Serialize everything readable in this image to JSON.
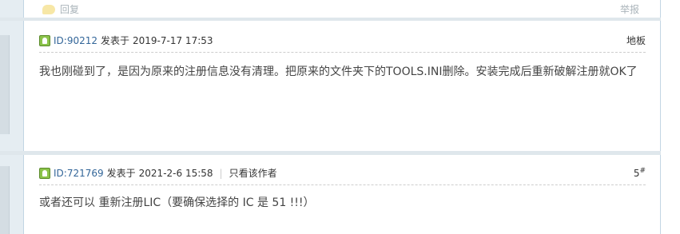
{
  "top_bar": {
    "reply_label": "回复",
    "report_label": "举报"
  },
  "posts": [
    {
      "author_id": "ID:90212",
      "posted_prefix": "发表于",
      "posted_time": "2019-7-17 17:53",
      "floor_label": "地板",
      "content": "我也刚碰到了，是因为原来的注册信息没有清理。把原来的文件夹下的TOOLS.INI删除。安装完成后重新破解注册就OK了"
    },
    {
      "author_id": "ID:721769",
      "posted_prefix": "发表于",
      "posted_time": "2021-2-6 15:58",
      "separator": "|",
      "only_author_label": "只看该作者",
      "floor_number": "5",
      "floor_suffix": "#",
      "content": "或者还可以 重新注册LIC（要确保选择的 IC 是 51 !!!）"
    }
  ],
  "colors": {
    "link": "#336699",
    "muted": "#aab4ba",
    "border": "#c2d5e3",
    "side_panel": "#e5edf2",
    "online_badge": "#8bc34a"
  },
  "icons": {
    "reply": "reply-bubble-icon",
    "online": "user-online-icon"
  }
}
